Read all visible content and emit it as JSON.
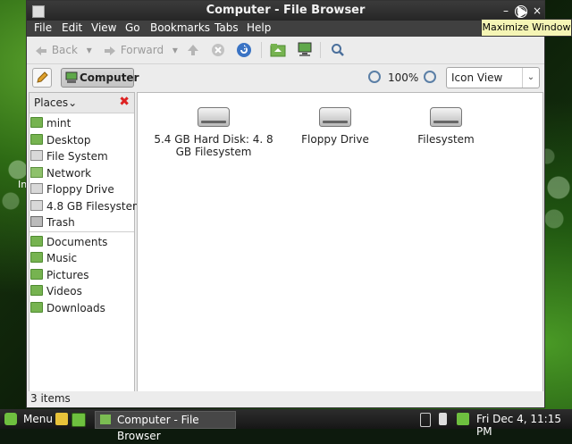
{
  "desktop": {
    "fragment_text": "In"
  },
  "window": {
    "title": "Computer - File Browser",
    "controls": {
      "minimize": "–",
      "maximize": "◯",
      "close": "×"
    }
  },
  "tooltip": "Maximize Window",
  "menubar": [
    "File",
    "Edit",
    "View",
    "Go",
    "Bookmarks",
    "Tabs",
    "Help"
  ],
  "toolbar": {
    "back_label": "Back",
    "forward_label": "Forward",
    "chevron": "▾"
  },
  "location": {
    "button_label": "Computer",
    "zoom_level": "100%",
    "view_mode": "Icon View",
    "view_arrow": "⌄"
  },
  "sidebar": {
    "header": "Places",
    "header_arrow": "⌄",
    "close_glyph": "✖",
    "places": [
      {
        "label": "mint",
        "icon": "folder-icon"
      },
      {
        "label": "Desktop",
        "icon": "folder-icon"
      },
      {
        "label": "File System",
        "icon": "drive-icon"
      },
      {
        "label": "Network",
        "icon": "network-icon"
      },
      {
        "label": "Floppy Drive",
        "icon": "drive-icon"
      },
      {
        "label": "4.8 GB Filesystem",
        "icon": "drive-icon"
      },
      {
        "label": "Trash",
        "icon": "trash-icon"
      }
    ],
    "bookmarks": [
      {
        "label": "Documents",
        "icon": "folder-icon"
      },
      {
        "label": "Music",
        "icon": "folder-icon"
      },
      {
        "label": "Pictures",
        "icon": "folder-icon"
      },
      {
        "label": "Videos",
        "icon": "folder-icon"
      },
      {
        "label": "Downloads",
        "icon": "folder-icon"
      }
    ]
  },
  "files": [
    {
      "label": "5.4 GB Hard Disk: 4. 8 GB Filesystem",
      "icon": "hard-disk-icon"
    },
    {
      "label": "Floppy Drive",
      "icon": "floppy-drive-icon"
    },
    {
      "label": "Filesystem",
      "icon": "filesystem-icon"
    }
  ],
  "status": {
    "items": "3 items"
  },
  "taskbar": {
    "menu_label": "Menu",
    "task_label": "Computer - File Browser",
    "clock": "Fri Dec  4, 11:15 PM"
  },
  "colors": {
    "titlebar": "#2f2f2f",
    "accent_green": "#76b350",
    "sidebar_close": "#dd2222",
    "tooltip_bg": "#f5f5b5"
  }
}
